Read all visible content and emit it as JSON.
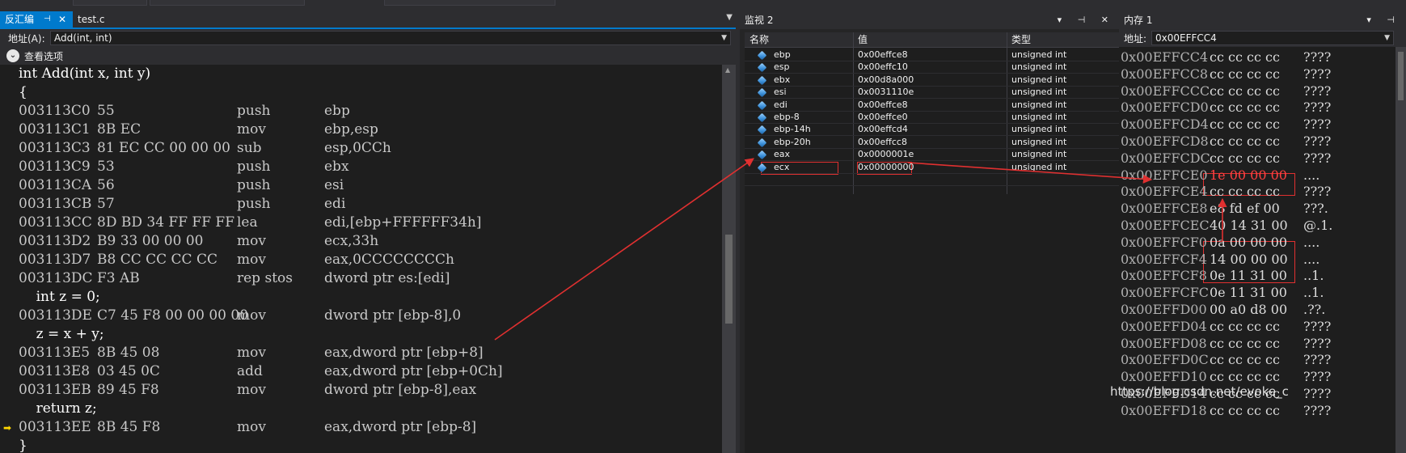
{
  "disasm": {
    "tab_active": "反汇编",
    "tab_pin": "⊣",
    "tab_close": "✕",
    "tab_file": "test.c",
    "address_label": "地址(A):",
    "address_value": "Add(int, int)",
    "view_options": "查看选项",
    "lines": [
      {
        "kind": "src",
        "text": "int Add(int x, int y)"
      },
      {
        "kind": "src",
        "text": "{"
      },
      {
        "kind": "asm",
        "addr": "003113C0",
        "bytes": "55",
        "op": "push",
        "arg": "ebp"
      },
      {
        "kind": "asm",
        "addr": "003113C1",
        "bytes": "8B EC",
        "op": "mov",
        "arg": "ebp,esp"
      },
      {
        "kind": "asm",
        "addr": "003113C3",
        "bytes": "81 EC CC 00 00 00",
        "op": "sub",
        "arg": "esp,0CCh"
      },
      {
        "kind": "asm",
        "addr": "003113C9",
        "bytes": "53",
        "op": "push",
        "arg": "ebx"
      },
      {
        "kind": "asm",
        "addr": "003113CA",
        "bytes": "56",
        "op": "push",
        "arg": "esi"
      },
      {
        "kind": "asm",
        "addr": "003113CB",
        "bytes": "57",
        "op": "push",
        "arg": "edi"
      },
      {
        "kind": "asm",
        "addr": "003113CC",
        "bytes": "8D BD 34 FF FF FF",
        "op": "lea",
        "arg": "edi,[ebp+FFFFFF34h]"
      },
      {
        "kind": "asm",
        "addr": "003113D2",
        "bytes": "B9 33 00 00 00",
        "op": "mov",
        "arg": "ecx,33h"
      },
      {
        "kind": "asm",
        "addr": "003113D7",
        "bytes": "B8 CC CC CC CC",
        "op": "mov",
        "arg": "eax,0CCCCCCCCh"
      },
      {
        "kind": "asm",
        "addr": "003113DC",
        "bytes": "F3 AB",
        "op": "rep stos",
        "arg": "dword ptr es:[edi]"
      },
      {
        "kind": "src",
        "text": "    int z = 0;"
      },
      {
        "kind": "asm",
        "addr": "003113DE",
        "bytes": "C7 45 F8 00 00 00 00",
        "op": "mov",
        "arg": "dword ptr [ebp-8],0"
      },
      {
        "kind": "src",
        "text": "    z = x + y;"
      },
      {
        "kind": "asm",
        "addr": "003113E5",
        "bytes": "8B 45 08",
        "op": "mov",
        "arg": "eax,dword ptr [ebp+8]"
      },
      {
        "kind": "asm",
        "addr": "003113E8",
        "bytes": "03 45 0C",
        "op": "add",
        "arg": "eax,dword ptr [ebp+0Ch]"
      },
      {
        "kind": "asm",
        "addr": "003113EB",
        "bytes": "89 45 F8",
        "op": "mov",
        "arg": "dword ptr [ebp-8],eax"
      },
      {
        "kind": "src",
        "text": "    return z;"
      },
      {
        "kind": "asm",
        "addr": "003113EE",
        "bytes": "8B 45 F8",
        "op": "mov",
        "arg": "eax,dword ptr [ebp-8]",
        "current": true
      },
      {
        "kind": "src",
        "text": "}"
      }
    ]
  },
  "watch": {
    "title": "监视 2",
    "controls": "▾ ⊣ ✕",
    "col_name": "名称",
    "col_value": "值",
    "col_type": "类型",
    "rows": [
      {
        "name": "ebp",
        "value": "0x00effce8",
        "type": "unsigned int"
      },
      {
        "name": "esp",
        "value": "0x00effc10",
        "type": "unsigned int"
      },
      {
        "name": "ebx",
        "value": "0x00d8a000",
        "type": "unsigned int"
      },
      {
        "name": "esi",
        "value": "0x0031110e",
        "type": "unsigned int"
      },
      {
        "name": "edi",
        "value": "0x00effce8",
        "type": "unsigned int"
      },
      {
        "name": "ebp-8",
        "value": "0x00effce0",
        "type": "unsigned int"
      },
      {
        "name": "ebp-14h",
        "value": "0x00effcd4",
        "type": "unsigned int"
      },
      {
        "name": "ebp-20h",
        "value": "0x00effcc8",
        "type": "unsigned int"
      },
      {
        "name": "eax",
        "value": "0x0000001e",
        "type": "unsigned int"
      },
      {
        "name": "ecx",
        "value": "0x00000000",
        "type": "unsigned int"
      }
    ]
  },
  "memory": {
    "title": "内存 1",
    "controls": "▾ ⊣",
    "address_label": "地址:",
    "address_value": "0x00EFFCC4",
    "rows": [
      {
        "addr": "0x00EFFCC4",
        "bytes": "cc cc cc cc",
        "chars": "????"
      },
      {
        "addr": "0x00EFFCC8",
        "bytes": "cc cc cc cc",
        "chars": "????"
      },
      {
        "addr": "0x00EFFCCC",
        "bytes": "cc cc cc cc",
        "chars": "????"
      },
      {
        "addr": "0x00EFFCD0",
        "bytes": "cc cc cc cc",
        "chars": "????"
      },
      {
        "addr": "0x00EFFCD4",
        "bytes": "cc cc cc cc",
        "chars": "????"
      },
      {
        "addr": "0x00EFFCD8",
        "bytes": "cc cc cc cc",
        "chars": "????"
      },
      {
        "addr": "0x00EFFCDC",
        "bytes": "cc cc cc cc",
        "chars": "????"
      },
      {
        "addr": "0x00EFFCE0",
        "bytes": "1e 00 00 00",
        "chars": "....",
        "highlight": true
      },
      {
        "addr": "0x00EFFCE4",
        "bytes": "cc cc cc cc",
        "chars": "????"
      },
      {
        "addr": "0x00EFFCE8",
        "bytes": "e8 fd ef 00",
        "chars": "???."
      },
      {
        "addr": "0x00EFFCEC",
        "bytes": "40 14 31 00",
        "chars": "@.1."
      },
      {
        "addr": "0x00EFFCF0",
        "bytes": "0a 00 00 00",
        "chars": "...."
      },
      {
        "addr": "0x00EFFCF4",
        "bytes": "14 00 00 00",
        "chars": "...."
      },
      {
        "addr": "0x00EFFCF8",
        "bytes": "0e 11 31 00",
        "chars": "..1."
      },
      {
        "addr": "0x00EFFCFC",
        "bytes": "0e 11 31 00",
        "chars": "..1."
      },
      {
        "addr": "0x00EFFD00",
        "bytes": "00 a0 d8 00",
        "chars": ".??."
      },
      {
        "addr": "0x00EFFD04",
        "bytes": "cc cc cc cc",
        "chars": "????"
      },
      {
        "addr": "0x00EFFD08",
        "bytes": "cc cc cc cc",
        "chars": "????"
      },
      {
        "addr": "0x00EFFD0C",
        "bytes": "cc cc cc cc",
        "chars": "????"
      },
      {
        "addr": "0x00EFFD10",
        "bytes": "cc cc cc cc",
        "chars": "????"
      },
      {
        "addr": "0x00EFFD14",
        "bytes": "cc cc cc cc",
        "chars": "????"
      },
      {
        "addr": "0x00EFFD18",
        "bytes": "cc cc cc cc",
        "chars": "????"
      }
    ]
  },
  "watermark": "https://blog.csdn.net/evoke_c",
  "colors": {
    "accent": "#007acc",
    "annotation": "#e03030",
    "current_line_marker": "#ffd700"
  }
}
